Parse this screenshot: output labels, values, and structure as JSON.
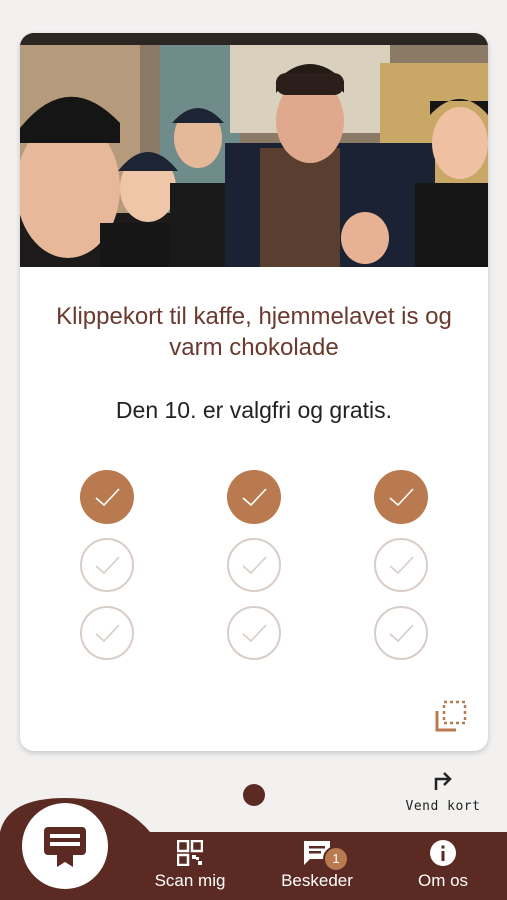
{
  "card": {
    "title": "Klippekort til kaffe, hjemmelavet is og varm chokolade",
    "subtitle": "Den 10. er valgfri og gratis.",
    "stamps": [
      true,
      true,
      true,
      false,
      false,
      false,
      false,
      false,
      false
    ]
  },
  "flip": {
    "label": "Vend kort"
  },
  "nav": {
    "scan_label": "Scan mig",
    "messages_label": "Besked​er",
    "messages_badge": "1",
    "about_label": "Om os"
  },
  "colors": {
    "brand_dark": "#5b2a22",
    "stamp_filled": "#b87a4e",
    "title_text": "#6b3a2e"
  },
  "icons": [
    "card-icon",
    "qr-code-icon",
    "chat-icon",
    "info-icon",
    "flip-arrow-icon",
    "corner-icon",
    "check-icon"
  ]
}
